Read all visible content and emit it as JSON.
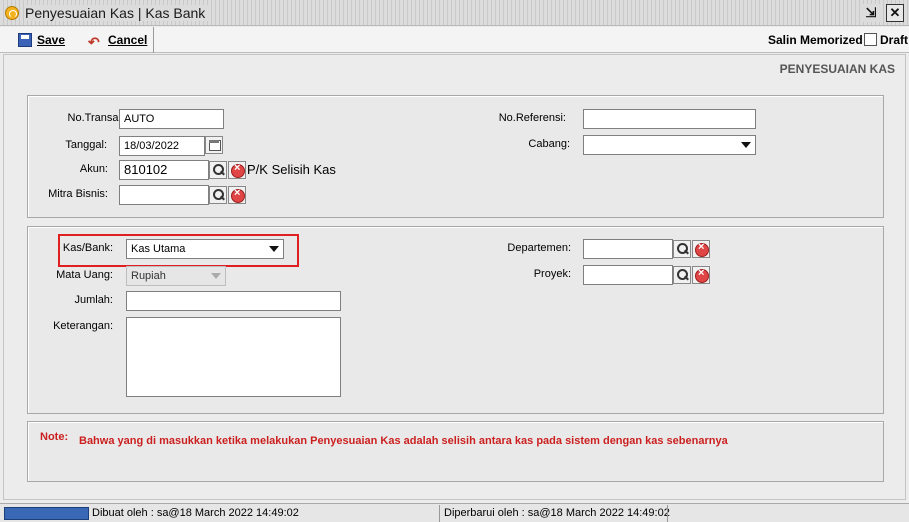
{
  "window": {
    "title": "Penyesuaian Kas | Kas Bank",
    "minimize_glyph": "⇲",
    "close_glyph": "✕"
  },
  "toolbar": {
    "save_label": "Save",
    "cancel_label": "Cancel",
    "salin_label": "Salin Memorized",
    "draft_label": "Draft"
  },
  "form": {
    "title": "PENYESUAIAN KAS"
  },
  "header_panel": {
    "no_transaksi": {
      "label": "No.Transaksi:",
      "value": "AUTO"
    },
    "tanggal": {
      "label": "Tanggal:",
      "value": "18/03/2022"
    },
    "akun": {
      "label": "Akun:",
      "value": "810102",
      "name": "P/K Selisih Kas"
    },
    "mitra_bisnis": {
      "label": "Mitra Bisnis:",
      "value": ""
    },
    "no_referensi": {
      "label": "No.Referensi:",
      "value": ""
    },
    "cabang": {
      "label": "Cabang:",
      "value": ""
    }
  },
  "detail_panel": {
    "kas_bank": {
      "label": "Kas/Bank:",
      "value": "Kas Utama"
    },
    "mata_uang": {
      "label": "Mata Uang:",
      "value": "Rupiah"
    },
    "jumlah": {
      "label": "Jumlah:",
      "value": ""
    },
    "keterangan": {
      "label": "Keterangan:",
      "value": ""
    },
    "departemen": {
      "label": "Departemen:",
      "value": ""
    },
    "proyek": {
      "label": "Proyek:",
      "value": ""
    }
  },
  "note": {
    "label": "Note:",
    "text": "Bahwa yang di masukkan ketika melakukan Penyesuaian Kas adalah selisih antara kas pada sistem dengan kas sebenarnya"
  },
  "statusbar": {
    "dibuat": "Dibuat oleh : sa@18 March 2022  14:49:02",
    "diperbarui": "Diperbarui oleh : sa@18 March 2022  14:49:02"
  },
  "colors": {
    "highlight_border": "#e02020",
    "note_text": "#cc1f1f",
    "progress": "#3a68b4"
  }
}
